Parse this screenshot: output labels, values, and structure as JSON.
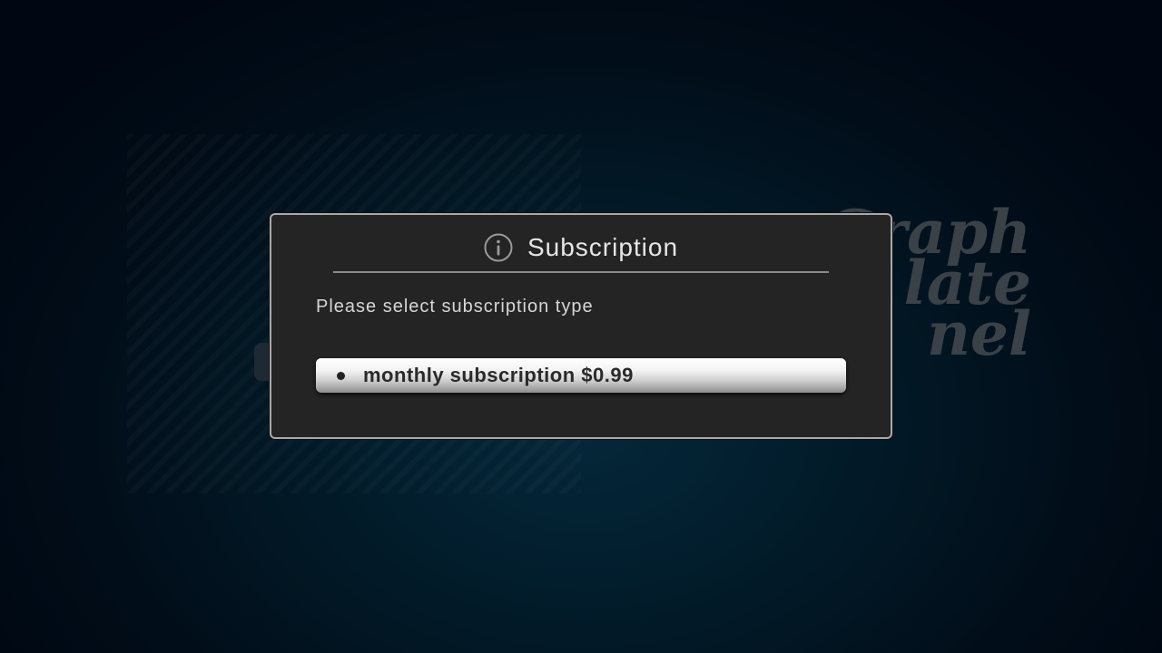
{
  "background": {
    "title_lines": [
      "Graph",
      "late",
      "nel"
    ]
  },
  "dialog": {
    "icon": "info-icon",
    "title": "Subscription",
    "message": "Please select subscription type",
    "options": [
      {
        "label": "monthly subscription $0.99",
        "selected": true
      }
    ]
  },
  "colors": {
    "dialog_bg": "#242424",
    "dialog_border": "#a9a9a9",
    "focus_button": "#f3f3f3"
  }
}
